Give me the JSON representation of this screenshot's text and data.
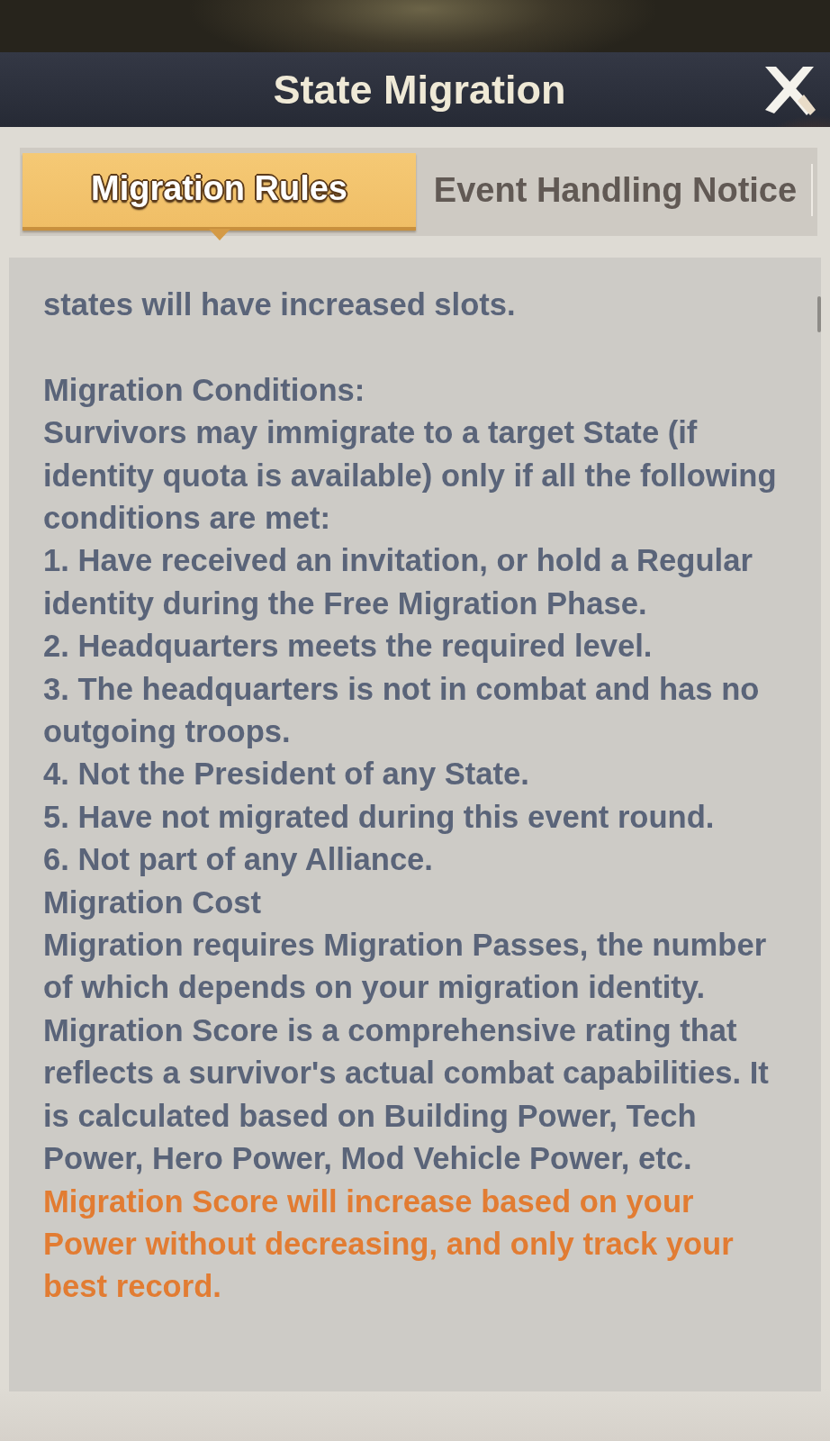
{
  "window": {
    "title": "State Migration"
  },
  "tabs": [
    {
      "label": "Migration Rules",
      "selected": true
    },
    {
      "label": "Event Handling Notice",
      "selected": false
    }
  ],
  "content": {
    "sections": [
      {
        "paragraphs": [
          {
            "kind": "text",
            "text": "states will have increased slots."
          }
        ]
      },
      {
        "paragraphs": [
          {
            "kind": "text",
            "text": "Migration Conditions:"
          },
          {
            "kind": "text",
            "text": "Survivors may immigrate to a target State (if identity quota is available) only if all the following conditions are met:"
          },
          {
            "kind": "text",
            "text": "1. Have received an invitation, or hold a Regular identity during the Free Migration Phase."
          },
          {
            "kind": "text",
            "text": "2. Headquarters meets the required level."
          },
          {
            "kind": "text",
            "text": "3. The headquarters is not in combat and has no outgoing troops."
          },
          {
            "kind": "text",
            "text": "4. Not the President of any State."
          },
          {
            "kind": "text",
            "text": "5. Have not migrated during this event round."
          },
          {
            "kind": "text",
            "text": "6. Not part of any Alliance."
          },
          {
            "kind": "text",
            "text": "Migration Cost"
          },
          {
            "kind": "text",
            "text": "Migration requires Migration Passes, the number of which depends on your migration identity."
          },
          {
            "kind": "text",
            "text": "Migration Score is a comprehensive rating that reflects a survivor's actual combat capabilities. It is calculated based on Building Power, Tech Power, Hero Power, Mod Vehicle Power, etc."
          },
          {
            "kind": "note",
            "text": "Migration Score will increase based on your Power without decreasing, and only track your best record."
          }
        ]
      }
    ]
  }
}
